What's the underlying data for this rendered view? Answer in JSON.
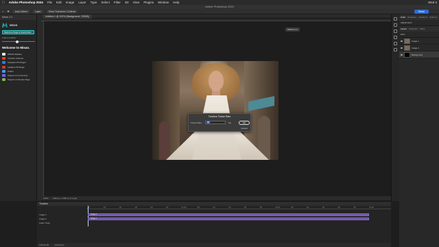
{
  "menubar": {
    "app_name": "Adobe Photoshop 2024",
    "items": [
      "File",
      "Edit",
      "Image",
      "Layer",
      "Type",
      "Select",
      "Filter",
      "3D",
      "View",
      "Plugins",
      "Window",
      "Help"
    ],
    "clock": "Wed 3"
  },
  "window": {
    "title": "Adobe Photoshop 2024"
  },
  "options_bar": {
    "opt1": "Auto-Select",
    "opt2": "Layer",
    "opt3": "Show Transform Controls",
    "share": "Share"
  },
  "left_panel": {
    "header": "Misan 2.0",
    "plugin_name": "MISAN",
    "select_value": "Welcome Page & Useful links",
    "slider_label": "Frame duration",
    "welcome_title": "Welcome to Misan.",
    "links": [
      {
        "label": "Official Website",
        "color": "#e8e8e8"
      },
      {
        "label": "Youtube Channel",
        "color": "#e03a2f"
      },
      {
        "label": "Artstation PS Plugin",
        "color": "#2e7fd8"
      },
      {
        "label": "Ladders PS Plugin",
        "color": "#cc3a3a"
      },
      {
        "label": "Twitter",
        "color": "#3ba0e6"
      },
      {
        "label": "Support & Community",
        "color": "#7a5cf0"
      },
      {
        "label": "Support on Envato Page",
        "color": "#7dbb46"
      }
    ]
  },
  "document": {
    "tab": "Untitled-1 @ 100% (Background, RGB/8)"
  },
  "floating_badge": "MISAN 2.0",
  "dialog": {
    "title": "Timeline Frame Rate",
    "label": "Frame Rate:",
    "value": "30",
    "unit": "fps",
    "ok": "OK",
    "cancel": "Cancel"
  },
  "status_bar": {
    "zoom": "100%",
    "info": "1080 px x 1350 px (72 ppi)"
  },
  "right_panel": {
    "tabs": [
      "Color",
      "Swatches",
      "Gradients",
      "Patterns"
    ],
    "adjustments": "Adjustments",
    "tabs2": [
      "Layers",
      "Channels",
      "Paths"
    ],
    "kind": "Kind",
    "layers": [
      {
        "name": "Image 1",
        "thumb": "photo"
      },
      {
        "name": "Image 2",
        "thumb": "photo"
      },
      {
        "name": "Background",
        "thumb": "black"
      }
    ]
  },
  "timeline": {
    "title": "Timeline",
    "tracks": [
      "Image 1",
      "Image 2",
      "Audio Track"
    ],
    "clips": [
      "Image 2",
      "Image 1"
    ],
    "time": "0:00:00:00",
    "fps_info": "(30.00 fps)",
    "ticks": [
      "00",
      "05f",
      "10f",
      "15f",
      "20f",
      "25f",
      "01:00f",
      "05f",
      "10f",
      "15f",
      "20f",
      "25f",
      "02:00f",
      "05f",
      "10f",
      "15f",
      "20f",
      "25f",
      "03:00f"
    ]
  }
}
